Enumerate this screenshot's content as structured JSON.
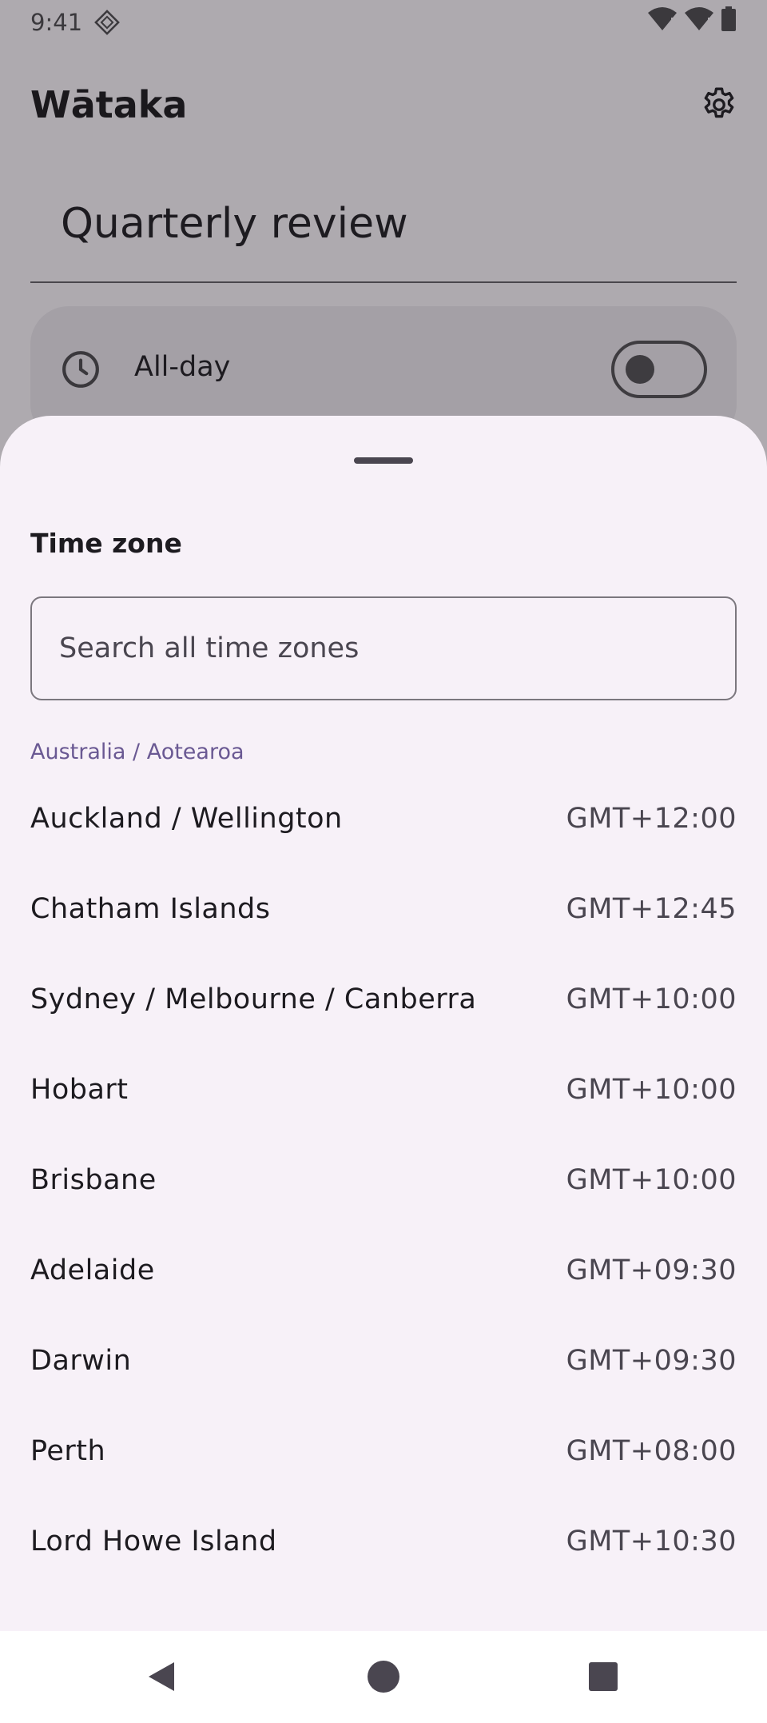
{
  "status_bar": {
    "time": "9:41",
    "icons": [
      "notification-icon",
      "wifi-icon",
      "signal-icon",
      "battery-icon"
    ]
  },
  "app_bar": {
    "title": "Wātaka",
    "settings_icon": "gear-icon"
  },
  "event": {
    "title": "Quarterly review",
    "all_day_label": "All-day",
    "all_day_enabled": false
  },
  "sheet": {
    "title": "Time zone",
    "search": {
      "placeholder": "Search all time zones",
      "value": ""
    },
    "section_header": "Australia / Aotearoa",
    "zones": [
      {
        "name": "Auckland / Wellington",
        "offset": "GMT+12:00"
      },
      {
        "name": "Chatham Islands",
        "offset": "GMT+12:45"
      },
      {
        "name": "Sydney / Melbourne / Canberra",
        "offset": "GMT+10:00"
      },
      {
        "name": "Hobart",
        "offset": "GMT+10:00"
      },
      {
        "name": "Brisbane",
        "offset": "GMT+10:00"
      },
      {
        "name": "Adelaide",
        "offset": "GMT+09:30"
      },
      {
        "name": "Darwin",
        "offset": "GMT+09:30"
      },
      {
        "name": "Perth",
        "offset": "GMT+08:00"
      },
      {
        "name": "Lord Howe Island",
        "offset": "GMT+10:30"
      }
    ]
  },
  "nav": {
    "icons": [
      "back-icon",
      "home-icon",
      "recents-icon"
    ]
  },
  "colors": {
    "scrim_background": "#aeaaaf",
    "sheet_background": "#f7f1f8",
    "accent": "#6a5993"
  }
}
